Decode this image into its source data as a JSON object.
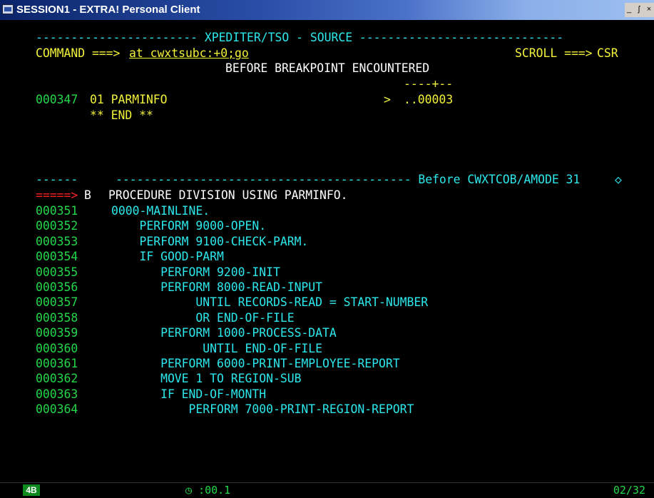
{
  "window": {
    "title": "SESSION1 - EXTRA! Personal Client",
    "minimize": "_",
    "restore": "ʃ",
    "close": "×"
  },
  "screen": {
    "header_line": "----------------------- XPEDITER/TSO - SOURCE -----------------------------",
    "command_label": "COMMAND ===>",
    "command_value": "at cwxtsubc:+0;go",
    "scroll_label": "SCROLL ===>",
    "scroll_value": "CSR",
    "message": "BEFORE BREAKPOINT ENCOUNTERED",
    "ruler": "----+--",
    "keep_line": {
      "number": "000347",
      "text": "01 PARMINFO",
      "marker": ">",
      "value": "..00003"
    },
    "end_marker": "** END **",
    "divider_left": "------",
    "divider_right": "------------------------------------------ Before CWXTCOB/AMODE 31",
    "divider_icon": "◇",
    "break_line": {
      "arrow": "=====>",
      "flag": "B",
      "text": "PROCEDURE DIVISION USING PARMINFO."
    },
    "source_lines": [
      {
        "number": "000351",
        "code": "0000-MAINLINE."
      },
      {
        "number": "000352",
        "code": "    PERFORM 9000-OPEN."
      },
      {
        "number": "000353",
        "code": "    PERFORM 9100-CHECK-PARM."
      },
      {
        "number": "000354",
        "code": "    IF GOOD-PARM"
      },
      {
        "number": "000355",
        "code": "       PERFORM 9200-INIT"
      },
      {
        "number": "000356",
        "code": "       PERFORM 8000-READ-INPUT"
      },
      {
        "number": "000357",
        "code": "            UNTIL RECORDS-READ = START-NUMBER"
      },
      {
        "number": "000358",
        "code": "            OR END-OF-FILE"
      },
      {
        "number": "000359",
        "code": "       PERFORM 1000-PROCESS-DATA"
      },
      {
        "number": "000360",
        "code": "             UNTIL END-OF-FILE"
      },
      {
        "number": "000361",
        "code": "       PERFORM 6000-PRINT-EMPLOYEE-REPORT"
      },
      {
        "number": "000362",
        "code": "       MOVE 1 TO REGION-SUB"
      },
      {
        "number": "000363",
        "code": "       IF END-OF-MONTH"
      },
      {
        "number": "000364",
        "code": "           PERFORM 7000-PRINT-REGION-REPORT"
      }
    ]
  },
  "status": {
    "session_box": "4B",
    "clock": ":00.1",
    "position": "02/32"
  },
  "colors": {
    "background": "#000000",
    "cyan": "#2ce8ec",
    "yellow": "#f2f23a",
    "green": "#22d84a",
    "red": "#ff2020",
    "white": "#ffffff"
  }
}
